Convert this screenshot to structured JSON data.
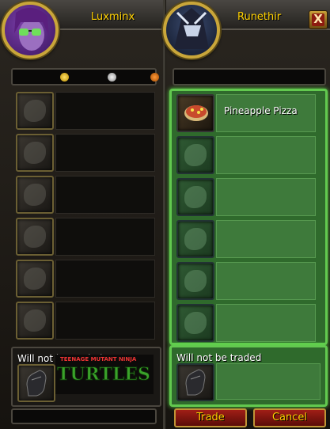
{
  "player": {
    "name": "Luxminx",
    "money_slots": [
      "gold-coin-icon",
      "silver-coin-icon",
      "copper-coin-icon"
    ],
    "items": [
      {
        "name": ""
      },
      {
        "name": ""
      },
      {
        "name": ""
      },
      {
        "name": ""
      },
      {
        "name": ""
      },
      {
        "name": ""
      }
    ],
    "not_traded_label": "Will not be traded",
    "logo_text_top": "TEENAGE MUTANT NINJA",
    "logo_text_main": "TURTLES"
  },
  "target": {
    "name": "Runethir",
    "items": [
      {
        "name": "Pineapple Pizza"
      },
      {
        "name": ""
      },
      {
        "name": ""
      },
      {
        "name": ""
      },
      {
        "name": ""
      },
      {
        "name": ""
      }
    ],
    "not_traded_label": "Will not be traded"
  },
  "buttons": {
    "trade": "Trade",
    "cancel": "Cancel",
    "close": "X"
  },
  "colors": {
    "accent_gold": "#ffd100",
    "accepted_green": "#62c94f",
    "button_red": "#a01e16"
  }
}
